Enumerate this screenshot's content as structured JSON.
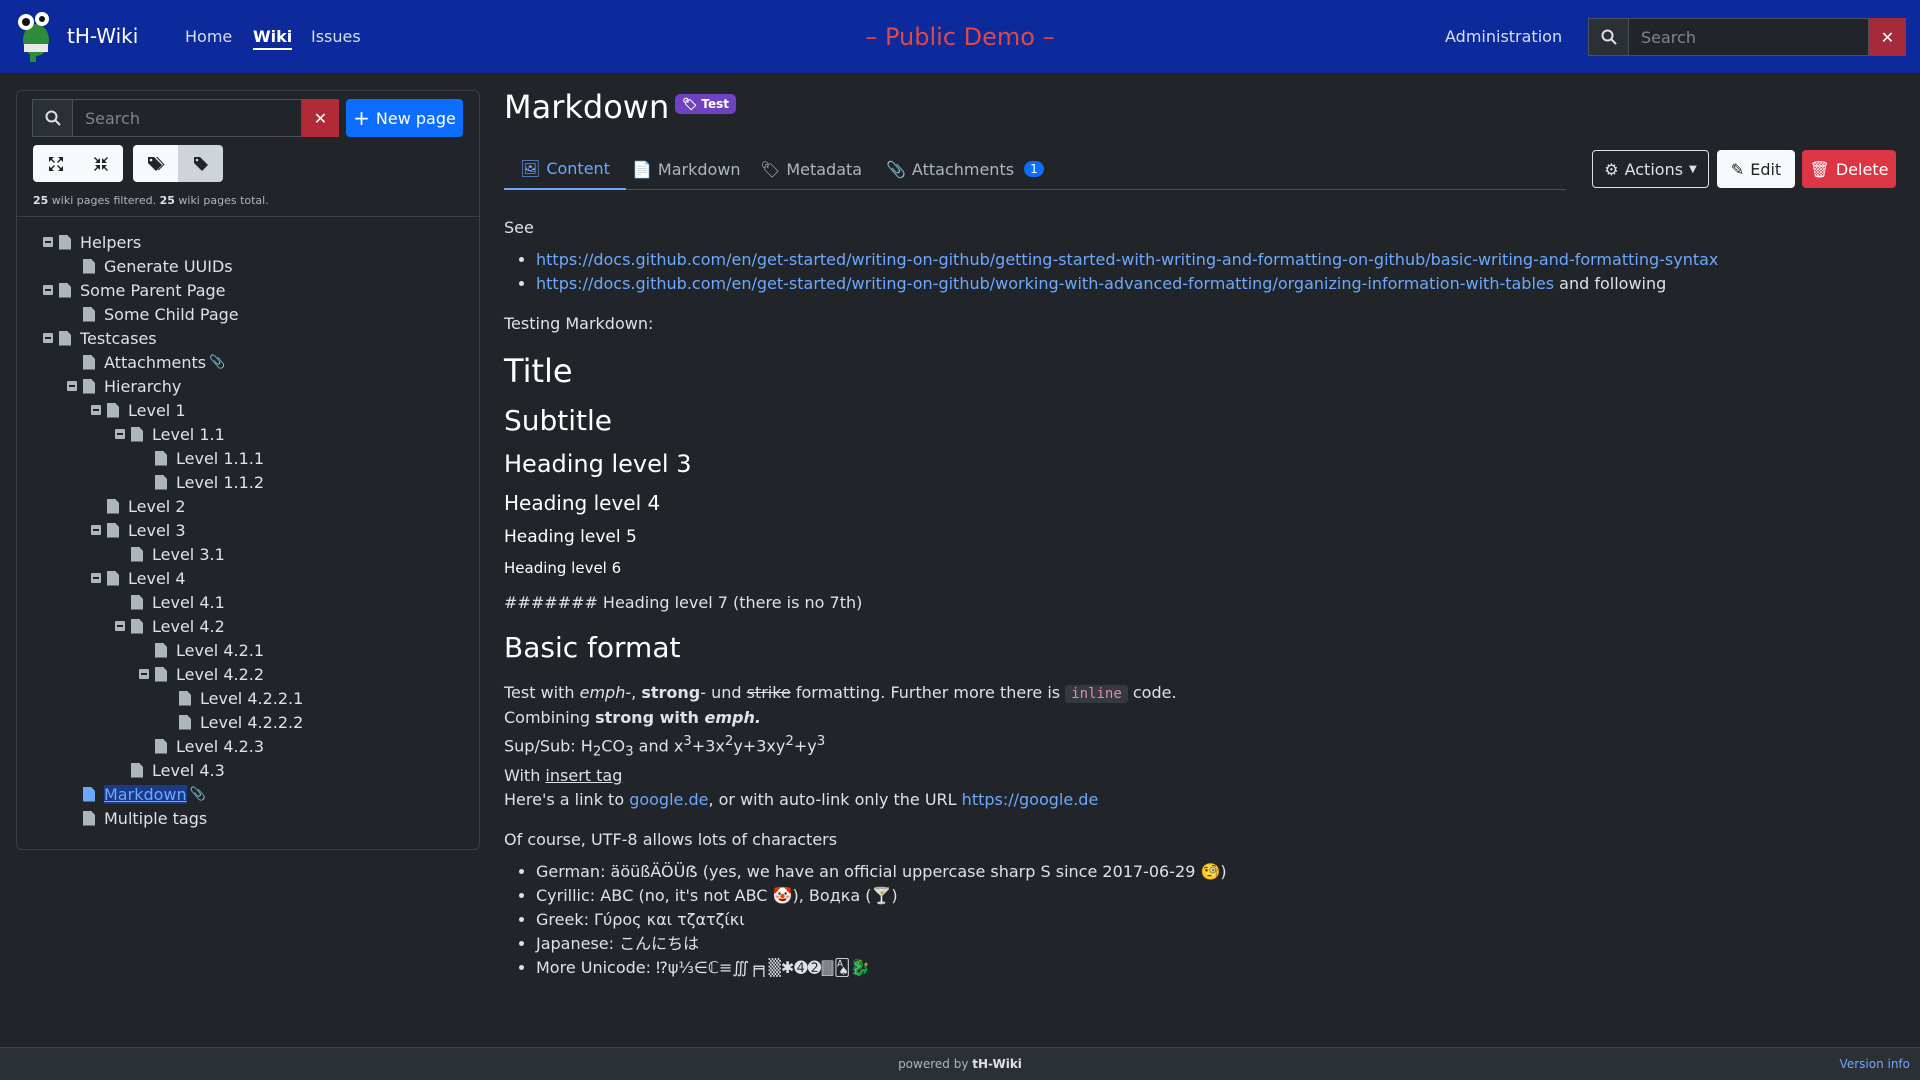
{
  "navbar": {
    "brand": "tH-Wiki",
    "home": "Home",
    "wiki": "Wiki",
    "issues": "Issues",
    "demo": "– Public Demo –",
    "admin": "Administration",
    "search_placeholder": "Search"
  },
  "sidebar": {
    "search_placeholder": "Search",
    "new_page": "New page",
    "filtered_count": "25",
    "filtered_text": " wiki pages filtered. ",
    "total_count": "25",
    "total_text": " wiki pages total."
  },
  "tree": [
    {
      "label": "Helpers",
      "depth": 0,
      "toggle": true
    },
    {
      "label": "Generate UUIDs",
      "depth": 1
    },
    {
      "label": "Some Parent Page",
      "depth": 0,
      "toggle": true
    },
    {
      "label": "Some Child Page",
      "depth": 1
    },
    {
      "label": "Testcases",
      "depth": 0,
      "toggle": true
    },
    {
      "label": "Attachments",
      "depth": 1,
      "clip": true
    },
    {
      "label": "Hierarchy",
      "depth": 1,
      "toggle": true
    },
    {
      "label": "Level 1",
      "depth": 2,
      "toggle": true
    },
    {
      "label": "Level 1.1",
      "depth": 3,
      "toggle": true
    },
    {
      "label": "Level 1.1.1",
      "depth": 4
    },
    {
      "label": "Level 1.1.2",
      "depth": 4
    },
    {
      "label": "Level 2",
      "depth": 2
    },
    {
      "label": "Level 3",
      "depth": 2,
      "toggle": true
    },
    {
      "label": "Level 3.1",
      "depth": 3
    },
    {
      "label": "Level 4",
      "depth": 2,
      "toggle": true
    },
    {
      "label": "Level 4.1",
      "depth": 3
    },
    {
      "label": "Level 4.2",
      "depth": 3,
      "toggle": true
    },
    {
      "label": "Level 4.2.1",
      "depth": 4
    },
    {
      "label": "Level 4.2.2",
      "depth": 4,
      "toggle": true
    },
    {
      "label": "Level 4.2.2.1",
      "depth": 5
    },
    {
      "label": "Level 4.2.2.2",
      "depth": 5
    },
    {
      "label": "Level 4.2.3",
      "depth": 4
    },
    {
      "label": "Level 4.3",
      "depth": 3
    },
    {
      "label": "Markdown",
      "depth": 1,
      "clip": true,
      "selected": true
    },
    {
      "label": "Multiple tags",
      "depth": 1
    }
  ],
  "page": {
    "title": "Markdown",
    "tag": "Test",
    "tabs": {
      "content": "Content",
      "markdown": "Markdown",
      "metadata": "Metadata",
      "attachments": "Attachments",
      "attachments_count": "1"
    },
    "actions": {
      "actions": "Actions",
      "edit": "Edit",
      "delete": "Delete"
    }
  },
  "md": {
    "see": "See",
    "link1": "https://docs.github.com/en/get-started/writing-on-github/getting-started-with-writing-and-formatting-on-github/basic-writing-and-formatting-syntax",
    "link2": "https://docs.github.com/en/get-started/writing-on-github/working-with-advanced-formatting/organizing-information-with-tables",
    "link2_after": " and following",
    "testing": "Testing Markdown:",
    "h1": "Title",
    "h2": "Subtitle",
    "h3": "Heading level 3",
    "h4": "Heading level 4",
    "h5": "Heading level 5",
    "h6": "Heading level 6",
    "h7": "####### Heading level 7 (there is no 7th)",
    "basic": "Basic format",
    "test_with": "Test with ",
    "emph": "emph",
    "dash_comma": "-, ",
    "strong": "strong",
    "dash_und": "- und ",
    "strike": "strike",
    "formatting": " formatting. Further more there is ",
    "inline": "inline",
    "code_end": " code.",
    "combining": "Combining ",
    "strong_with": "strong with ",
    "emph2": "emph.",
    "supsub_prefix": "Sup/Sub: H",
    "sub2": "2",
    "co": "CO",
    "sub3": "3",
    " and_x": " and x",
    "sup3": "3",
    "plus3x": "+3x",
    "sup2": "2",
    "y3xy": "y+3xy",
    "sup2b": "2",
    "plusy": "+y",
    "sup3b": "3",
    "with": "With ",
    "insert": "insert tag",
    "link_prefix": "Here's a link to ",
    "google": "google.de",
    "link_mid": ", or with auto-link only the URL ",
    "google_url": "https://google.de",
    "utf8": "Of course, UTF-8 allows lots of characters",
    "german": "German: äöüßÄÖÜẞ (yes, we have an official uppercase sharp S since 2017-06-29 🧐)",
    "cyrillic": "Cyrillic: АВС (no, it's not ABC 🤡), Водка (🍸)",
    "greek": "Greek: Γύρος και τζατζίκι",
    "japanese": "Japanese: こんにちは",
    "unicode": "More Unicode: ⁉ψ⅓∈ℂ≡∭╒╕▒✱➍➋🀫🂡🐉"
  },
  "footer": {
    "powered": "powered by ",
    "brand": "tH-Wiki",
    "version": "Version info"
  }
}
